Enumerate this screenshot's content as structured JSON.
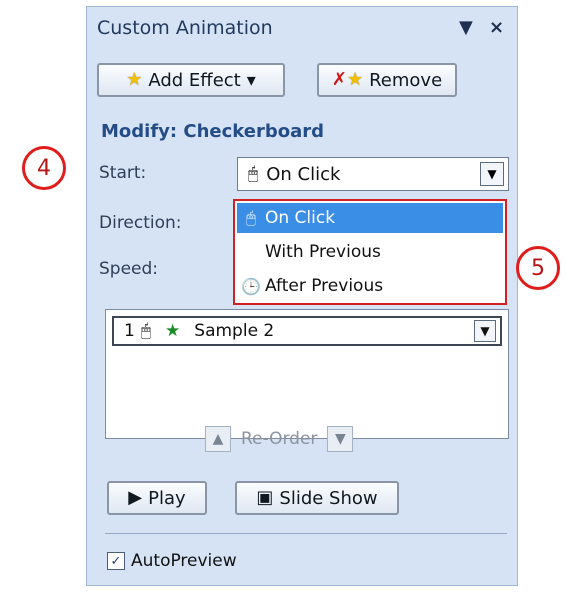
{
  "panel": {
    "title": "Custom Animation",
    "dropdown_glyph": "▼",
    "close_glyph": "×"
  },
  "buttons": {
    "add_effect": {
      "label": "Add Effect",
      "caret": "▾",
      "icon": "add-effect-star-icon"
    },
    "remove": {
      "label": "Remove",
      "icon": "remove-effect-icon"
    },
    "play": {
      "label": "Play",
      "icon": "play-icon"
    },
    "slide_show": {
      "label": "Slide Show",
      "icon": "slide-show-icon"
    }
  },
  "modify": {
    "heading": "Modify: Checkerboard",
    "start_label": "Start:",
    "direction_label": "Direction:",
    "speed_label": "Speed:"
  },
  "start_combo": {
    "selected": "On Click",
    "icon": "mouse-click-icon"
  },
  "start_options": [
    {
      "label": "On Click",
      "icon": "mouse-click-icon",
      "selected": true
    },
    {
      "label": "With Previous",
      "icon": "",
      "selected": false
    },
    {
      "label": "After Previous",
      "icon": "clock-icon",
      "selected": false
    }
  ],
  "effects_list": [
    {
      "number": "1",
      "trigger_icon": "mouse-click-icon",
      "effect_icon": "entrance-star-icon",
      "name": "Sample 2"
    }
  ],
  "reorder": {
    "label": "Re-Order",
    "up_icon": "arrow-up-icon",
    "down_icon": "arrow-down-icon"
  },
  "autopreview": {
    "label": "AutoPreview",
    "checked": true
  },
  "callouts": {
    "four": "4",
    "five": "5"
  },
  "colors": {
    "panel_bg": "#d6e3f5",
    "accent_text": "#244c86",
    "selection": "#3a8ee6",
    "callout": "#e11c1c"
  }
}
